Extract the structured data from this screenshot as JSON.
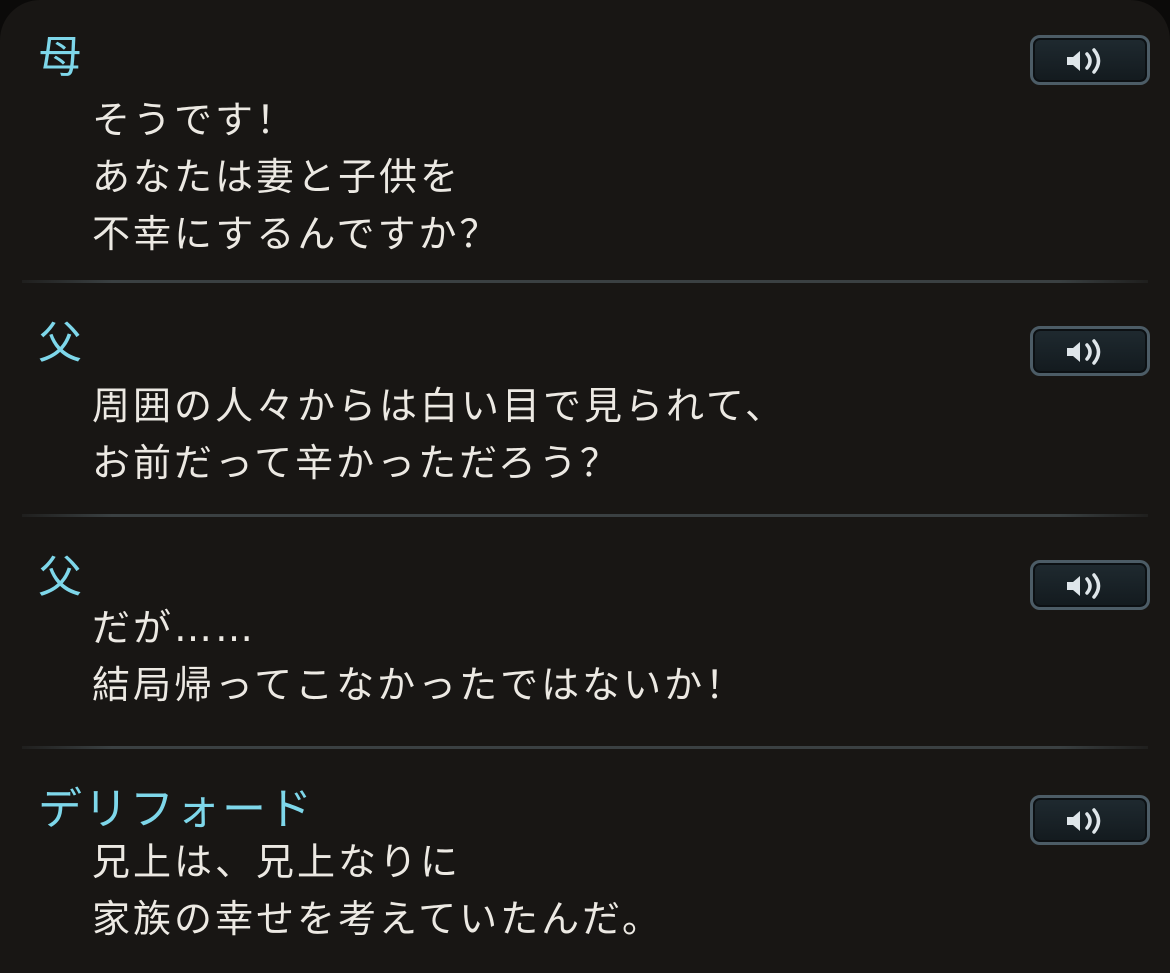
{
  "entries": [
    {
      "speaker": "母",
      "lines": [
        "そうです！",
        "あなたは妻と子供を",
        "不幸にするんですか？"
      ],
      "voice_icon": "speaker-icon"
    },
    {
      "speaker": "父",
      "lines": [
        "周囲の人々からは白い目で見られて、",
        "お前だって辛かっただろう？"
      ],
      "voice_icon": "speaker-icon"
    },
    {
      "speaker": "父",
      "lines": [
        "だが……",
        "結局帰ってこなかったではないか！"
      ],
      "voice_icon": "speaker-icon"
    },
    {
      "speaker": "デリフォード",
      "lines": [
        "兄上は、兄上なりに",
        "家族の幸せを考えていたんだ。"
      ],
      "voice_icon": "speaker-icon"
    }
  ],
  "colors": {
    "speaker_name": "#7ed7ea",
    "dialogue_text": "#ece9e3",
    "panel_background": "#181614",
    "button_border": "#4c5c66"
  }
}
